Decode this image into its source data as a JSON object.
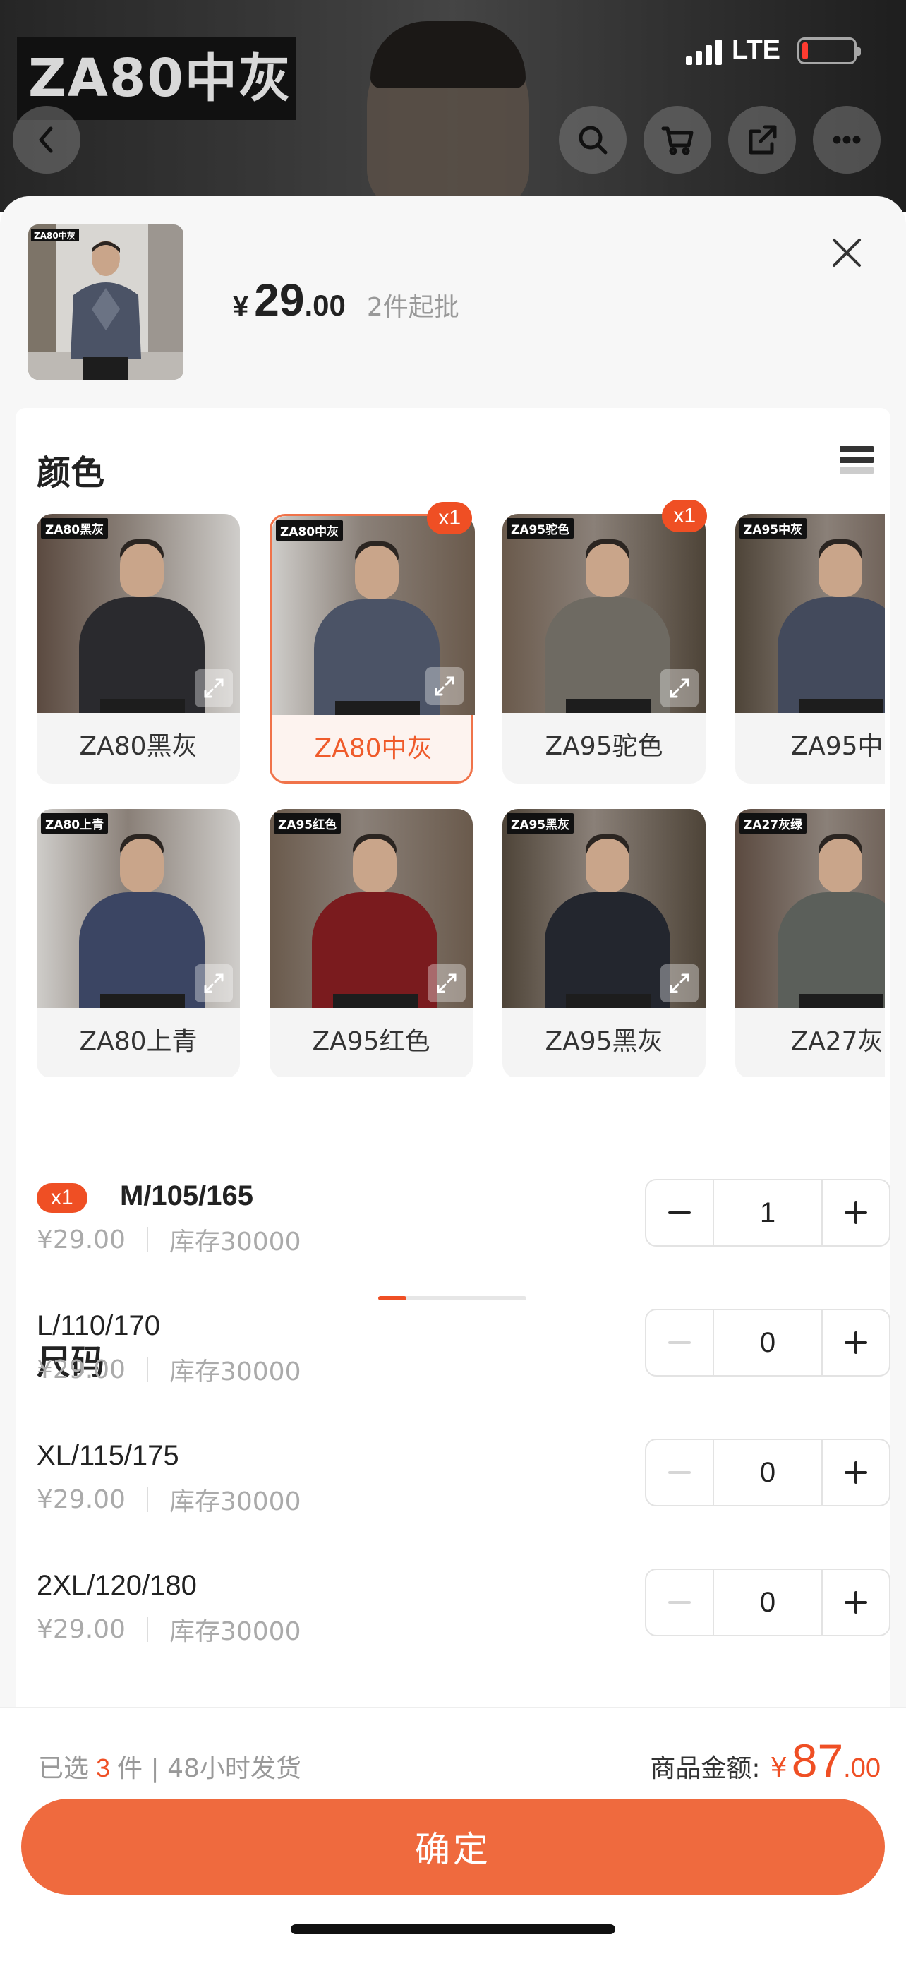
{
  "status_bar": {
    "network": "LTE"
  },
  "background": {
    "product_tag": "ZA80中灰"
  },
  "sheet": {
    "price": {
      "currency": "¥",
      "integer": "29",
      "decimal": ".00",
      "moq": "2件起批"
    },
    "color_section": {
      "title": "颜色",
      "swatches": [
        {
          "label": "ZA80黑灰",
          "tag": "ZA80黑灰",
          "shirt_color": "#2a2a2e",
          "count": ""
        },
        {
          "label": "ZA80中灰",
          "tag": "ZA80中灰",
          "shirt_color": "#4b5366",
          "count": "x1",
          "selected": true
        },
        {
          "label": "ZA95驼色",
          "tag": "ZA95驼色",
          "shirt_color": "#6e6a62",
          "count": "x1"
        },
        {
          "label": "ZA95中",
          "tag": "ZA95中灰",
          "shirt_color": "#434a5c",
          "count": ""
        },
        {
          "label": "ZA80上青",
          "tag": "ZA80上青",
          "shirt_color": "#3b4563",
          "count": ""
        },
        {
          "label": "ZA95红色",
          "tag": "ZA95红色",
          "shirt_color": "#7a1b1e",
          "count": ""
        },
        {
          "label": "ZA95黑灰",
          "tag": "ZA95黑灰",
          "shirt_color": "#23262e",
          "count": ""
        },
        {
          "label": "ZA27灰",
          "tag": "ZA27灰绿",
          "shirt_color": "#5b5f5a",
          "count": ""
        }
      ]
    },
    "size_section": {
      "title": "尺码",
      "sizes": [
        {
          "name": "M/105/165",
          "badge": "x1",
          "price": "¥29.00",
          "stock": "库存30000",
          "qty": "1"
        },
        {
          "name": "L/110/170",
          "badge": "",
          "price": "¥29.00",
          "stock": "库存30000",
          "qty": "0"
        },
        {
          "name": "XL/115/175",
          "badge": "",
          "price": "¥29.00",
          "stock": "库存30000",
          "qty": "0"
        },
        {
          "name": "2XL/120/180",
          "badge": "",
          "price": "¥29.00",
          "stock": "库存30000",
          "qty": "0"
        }
      ]
    },
    "footer": {
      "selected_prefix": "已选",
      "selected_count": "3",
      "selected_suffix": "件 | 48小时发货",
      "total_label": "商品金额:",
      "total_currency": "¥",
      "total_integer": "87",
      "total_decimal": ".00",
      "confirm_label": "确定"
    }
  },
  "colors": {
    "accent": "#ef4f24",
    "button": "#ef6a3e"
  }
}
